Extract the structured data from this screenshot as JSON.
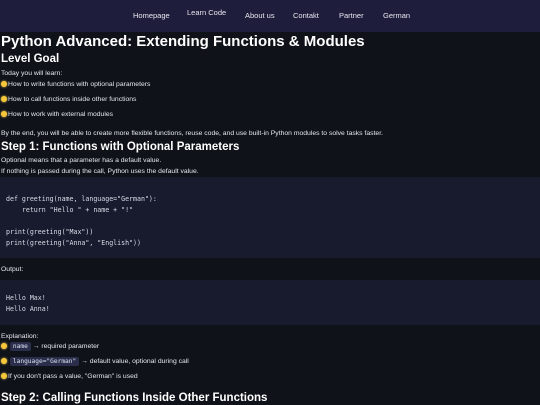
{
  "nav": {
    "items": [
      "Homepage",
      "Learn Code",
      "About us",
      "Contakt",
      "Partner",
      "German"
    ]
  },
  "page": {
    "title": "Python Advanced: Extending Functions & Modules"
  },
  "level_goal": {
    "heading": "Level Goal",
    "intro": "Today you will learn:",
    "bullets": [
      "How to write functions with optional parameters",
      "How to call functions inside other functions",
      "How to work with external modules"
    ],
    "summary": "By the end, you will be able to create more flexible functions, reuse code, and use built-in Python modules to solve tasks faster."
  },
  "step1": {
    "heading": "Step 1: Functions with Optional Parameters",
    "line1": "Optional means that a parameter has a default value.",
    "line2": "If nothing is passed during the call, Python uses the default value.",
    "code_lines": [
      "def greeting(name, language=\"German\"):",
      "    return \"Hello \" + name + \"!\"",
      "",
      "print(greeting(\"Max\"))",
      "print(greeting(\"Anna\", \"English\"))"
    ],
    "output_label": "Output:",
    "output_lines": [
      "Hello Max!",
      "Hello Anna!"
    ],
    "explanation_label": "Explanation:",
    "exp1_code": "name",
    "exp1_text": "→ required parameter",
    "exp2_code": "language=\"German\"",
    "exp2_text": "→ default value, optional during call",
    "exp3_text": "If you don't pass a value, \"German\" is used"
  },
  "step2": {
    "heading": "Step 2: Calling Functions Inside Other Functions"
  },
  "colors": {
    "nav_bg": "#1f1d3c",
    "page_bg": "#0f1219",
    "code_bg": "#181b2e",
    "bulb": "#f6c73b"
  }
}
